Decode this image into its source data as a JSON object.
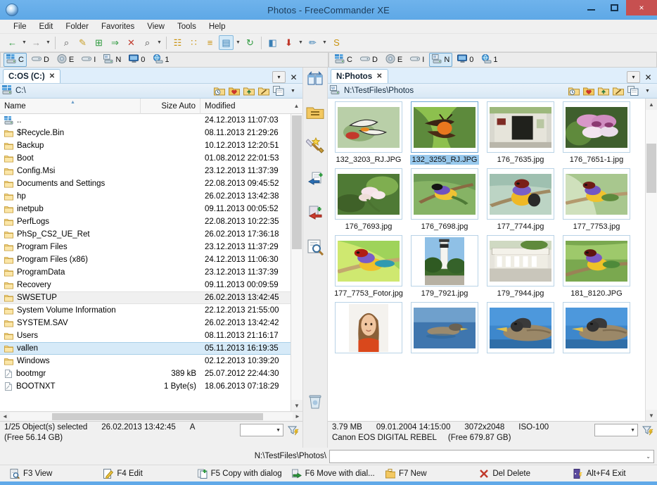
{
  "window": {
    "title": "Photos - FreeCommander XE",
    "app_icon": "app-globe-icon",
    "minimize": "–",
    "maximize": "□",
    "close": "×"
  },
  "menubar": {
    "items": [
      {
        "label": "File"
      },
      {
        "label": "Edit"
      },
      {
        "label": "Folder"
      },
      {
        "label": "Favorites"
      },
      {
        "label": "View"
      },
      {
        "label": "Tools"
      },
      {
        "label": "Help"
      }
    ]
  },
  "toolbar": {
    "buttons": [
      {
        "name": "back-icon",
        "glyph": "←",
        "color": "#2e9a3e",
        "dropdown": true,
        "active": false
      },
      {
        "name": "forward-icon",
        "glyph": "→",
        "color": "#9a9a9a",
        "dropdown": true,
        "active": false
      },
      {
        "name": "sep",
        "glyph": "",
        "color": "",
        "dropdown": false,
        "active": false
      },
      {
        "name": "view-icon",
        "glyph": "⌕",
        "color": "#555",
        "dropdown": false,
        "active": false
      },
      {
        "name": "edit-icon",
        "glyph": "✎",
        "color": "#c9a12b",
        "dropdown": false,
        "active": false
      },
      {
        "name": "copy-icon",
        "glyph": "⊞",
        "color": "#2e9a3e",
        "dropdown": false,
        "active": false
      },
      {
        "name": "move-icon",
        "glyph": "⇒",
        "color": "#2e9a3e",
        "dropdown": false,
        "active": false
      },
      {
        "name": "delete-icon",
        "glyph": "✕",
        "color": "#c0392b",
        "dropdown": false,
        "active": false
      },
      {
        "name": "search-icon",
        "glyph": "⌕",
        "color": "#444",
        "dropdown": true,
        "active": false
      },
      {
        "name": "sep",
        "glyph": "",
        "color": "",
        "dropdown": false,
        "active": false
      },
      {
        "name": "tree-view-icon",
        "glyph": "☷",
        "color": "#c9920f",
        "dropdown": false,
        "active": false
      },
      {
        "name": "large-icons-view-icon",
        "glyph": "∷",
        "color": "#c9920f",
        "dropdown": false,
        "active": false
      },
      {
        "name": "details-view-icon",
        "glyph": "≡",
        "color": "#c9920f",
        "dropdown": false,
        "active": false
      },
      {
        "name": "thumbnail-view-icon",
        "glyph": "▤",
        "color": "#3a7fb5",
        "dropdown": true,
        "active": true
      },
      {
        "name": "refresh-icon",
        "glyph": "↻",
        "color": "#2e9a3e",
        "dropdown": false,
        "active": false
      },
      {
        "name": "sep",
        "glyph": "",
        "color": "",
        "dropdown": false,
        "active": false
      },
      {
        "name": "open-folder-icon",
        "glyph": "◧",
        "color": "#3a7fb5",
        "dropdown": false,
        "active": false
      },
      {
        "name": "pack-icon",
        "glyph": "⬇",
        "color": "#c0392b",
        "dropdown": true,
        "active": false
      },
      {
        "name": "multi-rename-icon",
        "glyph": "✏",
        "color": "#3a7fb5",
        "dropdown": true,
        "active": false
      },
      {
        "name": "sync-icon",
        "glyph": "S",
        "color": "#c9920f",
        "dropdown": false,
        "active": false
      }
    ]
  },
  "drivebar": {
    "left": {
      "drives": [
        {
          "label": "C",
          "icon": "local-disk-icon",
          "active": true
        },
        {
          "label": "D",
          "icon": "removable-disk-icon",
          "active": false
        },
        {
          "label": "E",
          "icon": "cd-drive-icon",
          "active": false
        },
        {
          "label": "I",
          "icon": "removable-disk-icon",
          "active": false
        },
        {
          "label": "N",
          "icon": "network-drive-icon",
          "active": false
        },
        {
          "label": "0",
          "icon": "desktop-icon",
          "active": false
        },
        {
          "label": "1",
          "icon": "network-icon",
          "active": false
        }
      ]
    },
    "right": {
      "drives": [
        {
          "label": "C",
          "icon": "local-disk-icon",
          "active": false
        },
        {
          "label": "D",
          "icon": "removable-disk-icon",
          "active": false
        },
        {
          "label": "E",
          "icon": "cd-drive-icon",
          "active": false
        },
        {
          "label": "I",
          "icon": "removable-disk-icon",
          "active": false
        },
        {
          "label": "N",
          "icon": "network-drive-icon",
          "active": true
        },
        {
          "label": "0",
          "icon": "desktop-icon",
          "active": false
        },
        {
          "label": "1",
          "icon": "network-icon",
          "active": false
        }
      ]
    }
  },
  "midbar": {
    "buttons": [
      {
        "name": "swap-panels-icon",
        "glyph": "⇄"
      },
      {
        "name": "same-folder-icon",
        "glyph": "☰"
      },
      {
        "name": "favorites-icon",
        "glyph": "★"
      },
      {
        "name": "copy-left-icon",
        "glyph": "←"
      },
      {
        "name": "move-right-icon",
        "glyph": "→"
      },
      {
        "name": "compare-icon",
        "glyph": "⌕"
      },
      {
        "name": "trash-icon",
        "glyph": "Ὕ1"
      }
    ]
  },
  "left_panel": {
    "tab": {
      "label": "C:OS (C:)",
      "close": "✕"
    },
    "tab_controls": {
      "dropdown": "▾",
      "close": "✕"
    },
    "path": "C:\\",
    "path_icon": "local-disk-icon",
    "path_buttons": [
      {
        "name": "recent-folders-icon",
        "glyph": "◴"
      },
      {
        "name": "favorites-icon",
        "glyph": "♥"
      },
      {
        "name": "parent-folder-icon",
        "glyph": "↑"
      },
      {
        "name": "root-folder-icon",
        "glyph": "\\"
      },
      {
        "name": "copy-path-icon",
        "glyph": "⧉"
      },
      {
        "name": "path-dropdown-icon",
        "glyph": "▾"
      }
    ],
    "columns": [
      {
        "key": "name",
        "label": "Name",
        "sorted": true
      },
      {
        "key": "size",
        "label": "Size Auto",
        "sorted": false
      },
      {
        "key": "modified",
        "label": "Modified",
        "sorted": false
      }
    ],
    "rows": [
      {
        "icon": "drive-up-icon",
        "name": "..",
        "size": "",
        "modified": "24.12.2013 11:07:03",
        "state": ""
      },
      {
        "icon": "folder-icon",
        "name": "$Recycle.Bin",
        "size": "",
        "modified": "08.11.2013 21:29:26",
        "state": ""
      },
      {
        "icon": "folder-icon",
        "name": "Backup",
        "size": "",
        "modified": "10.12.2013 12:20:51",
        "state": ""
      },
      {
        "icon": "folder-icon",
        "name": "Boot",
        "size": "",
        "modified": "01.08.2012 22:01:53",
        "state": ""
      },
      {
        "icon": "folder-icon",
        "name": "Config.Msi",
        "size": "",
        "modified": "23.12.2013 11:37:39",
        "state": ""
      },
      {
        "icon": "folder-icon",
        "name": "Documents and Settings",
        "size": "",
        "modified": "22.08.2013 09:45:52",
        "state": ""
      },
      {
        "icon": "folder-icon",
        "name": "hp",
        "size": "",
        "modified": "26.02.2013 13:42:38",
        "state": ""
      },
      {
        "icon": "folder-icon",
        "name": "inetpub",
        "size": "",
        "modified": "09.11.2013 00:05:52",
        "state": ""
      },
      {
        "icon": "folder-icon",
        "name": "PerfLogs",
        "size": "",
        "modified": "22.08.2013 10:22:35",
        "state": ""
      },
      {
        "icon": "folder-icon",
        "name": "PhSp_CS2_UE_Ret",
        "size": "",
        "modified": "26.02.2013 17:36:18",
        "state": ""
      },
      {
        "icon": "folder-icon",
        "name": "Program Files",
        "size": "",
        "modified": "23.12.2013 11:37:29",
        "state": ""
      },
      {
        "icon": "folder-icon",
        "name": "Program Files (x86)",
        "size": "",
        "modified": "24.12.2013 11:06:30",
        "state": ""
      },
      {
        "icon": "folder-icon",
        "name": "ProgramData",
        "size": "",
        "modified": "23.12.2013 11:37:39",
        "state": ""
      },
      {
        "icon": "folder-icon",
        "name": "Recovery",
        "size": "",
        "modified": "09.11.2013 00:09:59",
        "state": ""
      },
      {
        "icon": "folder-icon",
        "name": "SWSETUP",
        "size": "",
        "modified": "26.02.2013 13:42:45",
        "state": "sel-weak"
      },
      {
        "icon": "folder-icon",
        "name": "System Volume Information",
        "size": "",
        "modified": "22.12.2013 21:55:00",
        "state": ""
      },
      {
        "icon": "folder-icon",
        "name": "SYSTEM.SAV",
        "size": "",
        "modified": "26.02.2013 13:42:42",
        "state": ""
      },
      {
        "icon": "folder-icon",
        "name": "Users",
        "size": "",
        "modified": "08.11.2013 21:16:17",
        "state": ""
      },
      {
        "icon": "folder-icon",
        "name": "vallen",
        "size": "",
        "modified": "05.11.2013 16:19:35",
        "state": "sel"
      },
      {
        "icon": "folder-icon",
        "name": "Windows",
        "size": "",
        "modified": "02.12.2013 10:39:20",
        "state": ""
      },
      {
        "icon": "file-icon",
        "name": "bootmgr",
        "size": "389 kB",
        "modified": "25.07.2012 22:44:30",
        "state": ""
      },
      {
        "icon": "file-icon",
        "name": "BOOTNXT",
        "size": "1 Byte(s)",
        "modified": "18.06.2013 07:18:29",
        "state": ""
      }
    ],
    "status": {
      "selected": "1/25 Object(s) selected",
      "modified": "26.02.2013 13:42:45",
      "attr": "A",
      "free": "(Free 56.14 GB)",
      "filter_value": "",
      "filter_icon": "filter-icon"
    }
  },
  "right_panel": {
    "tab": {
      "label": "N:Photos",
      "close": "✕"
    },
    "tab_controls": {
      "dropdown": "▾",
      "close": "✕"
    },
    "path": "N:\\TestFiles\\Photos",
    "path_icon": "network-drive-icon",
    "path_buttons": [
      {
        "name": "recent-folders-icon",
        "glyph": "◴"
      },
      {
        "name": "favorites-icon",
        "glyph": "♥"
      },
      {
        "name": "parent-folder-icon",
        "glyph": "↑"
      },
      {
        "name": "root-folder-icon",
        "glyph": "\\"
      },
      {
        "name": "copy-path-icon",
        "glyph": "⧉"
      },
      {
        "name": "path-dropdown-icon",
        "glyph": "▾"
      }
    ],
    "thumbnails": [
      {
        "label": "132_3203_RJ.JPG",
        "selected": false,
        "kind": "butterfly-white",
        "orientation": "landscape"
      },
      {
        "label": "132_3255_RJ.JPG",
        "selected": true,
        "kind": "butterfly-orange",
        "orientation": "landscape"
      },
      {
        "label": "176_7635.jpg",
        "selected": false,
        "kind": "storefront",
        "orientation": "landscape"
      },
      {
        "label": "176_7651-1.jpg",
        "selected": false,
        "kind": "orchid",
        "orientation": "landscape"
      },
      {
        "label": "176_7693.jpg",
        "selected": false,
        "kind": "blossom",
        "orientation": "landscape"
      },
      {
        "label": "176_7698.jpg",
        "selected": false,
        "kind": "finch-leaf",
        "orientation": "landscape"
      },
      {
        "label": "177_7744.jpg",
        "selected": false,
        "kind": "finch-front",
        "orientation": "landscape"
      },
      {
        "label": "177_7753.jpg",
        "selected": false,
        "kind": "finch-branch",
        "orientation": "landscape"
      },
      {
        "label": "177_7753_Fotor.jpg",
        "selected": false,
        "kind": "finch-bright",
        "orientation": "landscape"
      },
      {
        "label": "179_7921.jpg",
        "selected": false,
        "kind": "lighthouse",
        "orientation": "portrait"
      },
      {
        "label": "179_7944.jpg",
        "selected": false,
        "kind": "sloppy-joes",
        "orientation": "landscape"
      },
      {
        "label": "181_8120.JPG",
        "selected": false,
        "kind": "finch-green",
        "orientation": "landscape"
      },
      {
        "label": "",
        "selected": false,
        "kind": "girl-portrait",
        "orientation": "portrait"
      },
      {
        "label": "",
        "selected": false,
        "kind": "duck-swim",
        "orientation": "landscape"
      },
      {
        "label": "",
        "selected": false,
        "kind": "duck-closeup",
        "orientation": "landscape"
      },
      {
        "label": "",
        "selected": false,
        "kind": "duck-closeup2",
        "orientation": "landscape"
      }
    ],
    "status": {
      "size": "3.79 MB",
      "date": "09.01.2004 14:15:00",
      "dimensions": "3072x2048",
      "iso": "ISO-100",
      "camera": "Canon EOS DIGITAL REBEL",
      "free": "(Free 679.87 GB)",
      "filter_value": "",
      "filter_icon": "filter-icon"
    }
  },
  "command_bar": {
    "path_prefix": "N:\\TestFiles\\Photos\\",
    "input_value": "",
    "dropdown": "⌄"
  },
  "function_keys": [
    {
      "icon": "view-icon",
      "label": "F3 View"
    },
    {
      "icon": "edit-icon",
      "label": "F4 Edit"
    },
    {
      "icon": "copy-icon",
      "label": "F5 Copy with dialog"
    },
    {
      "icon": "move-icon",
      "label": "F6 Move with dial..."
    },
    {
      "icon": "new-folder-icon",
      "label": "F7 New"
    },
    {
      "icon": "delete-icon",
      "label": "Del Delete"
    },
    {
      "icon": "exit-icon",
      "label": "Alt+F4 Exit"
    }
  ],
  "colors": {
    "title_bg": "#60a9e8",
    "close_btn": "#c75050",
    "selection": "#d6eaf8",
    "thumb_selection": "#98c9ed",
    "accent": "#3a7fb5"
  }
}
